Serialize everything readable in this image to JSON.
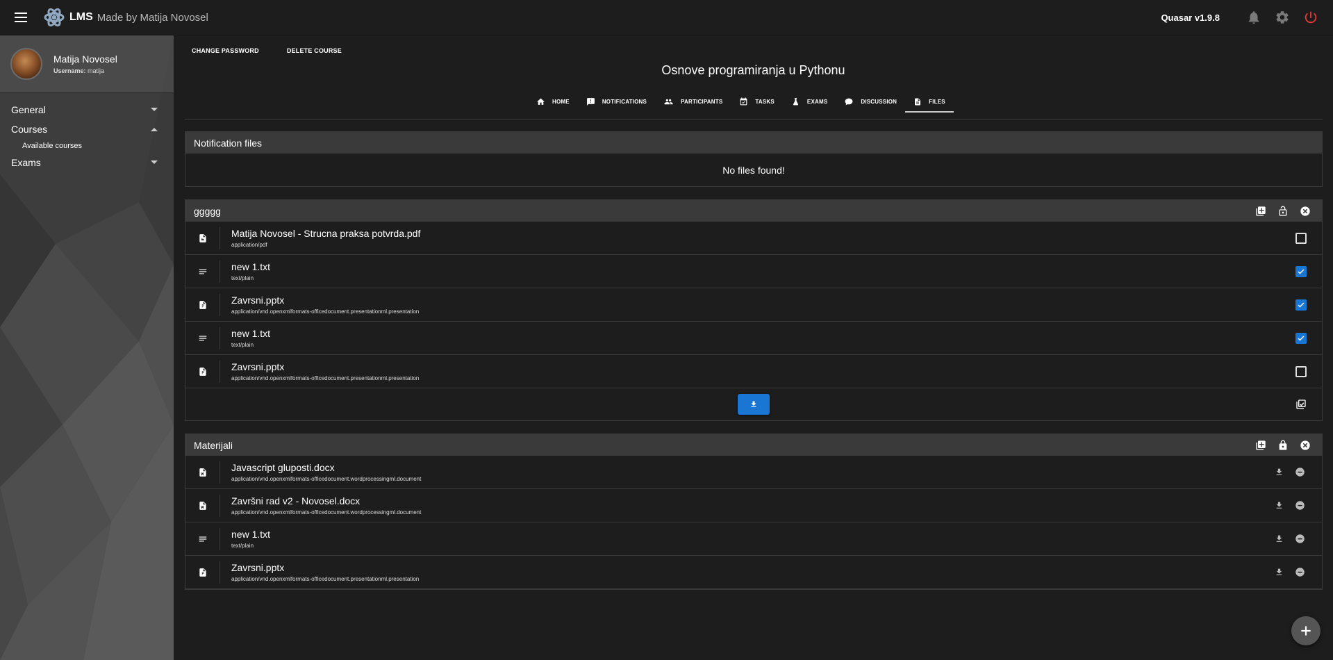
{
  "header": {
    "app_title": "LMS",
    "app_subtitle": "Made by Matija Novosel",
    "version": "Quasar v1.9.8",
    "icons": [
      "menu-icon",
      "atom-logo-icon",
      "bell-icon",
      "gear-icon",
      "power-icon"
    ]
  },
  "sidebar": {
    "user": {
      "name": "Matija Novosel",
      "username_label": "Username:",
      "username": "matija"
    },
    "items": [
      {
        "label": "General",
        "state": "collapsed"
      },
      {
        "label": "Courses",
        "state": "expanded"
      },
      {
        "label": "Available courses"
      },
      {
        "label": "Exams",
        "state": "collapsed"
      }
    ]
  },
  "main": {
    "actions": {
      "change_password": "CHANGE PASSWORD",
      "delete_course": "DELETE COURSE"
    },
    "course_title": "Osnove programiranja u Pythonu",
    "tabs": [
      {
        "label": "HOME",
        "icon": "home-icon"
      },
      {
        "label": "NOTIFICATIONS",
        "icon": "feedback-icon"
      },
      {
        "label": "PARTICIPANTS",
        "icon": "people-icon"
      },
      {
        "label": "TASKS",
        "icon": "event-available-icon"
      },
      {
        "label": "EXAMS",
        "icon": "flask-icon"
      },
      {
        "label": "DISCUSSION",
        "icon": "forum-icon"
      },
      {
        "label": "FILES",
        "icon": "file-icon",
        "active": true
      }
    ],
    "notification_files": {
      "title": "Notification files",
      "empty_text": "No files found!"
    },
    "folder1": {
      "title": "ggggg",
      "files": [
        {
          "name": "Matija Novosel - Strucna praksa potvrda.pdf",
          "mime": "application/pdf",
          "icon": "pdf-file-icon",
          "checked": false
        },
        {
          "name": "new 1.txt",
          "mime": "text/plain",
          "icon": "text-lines-icon",
          "checked": true
        },
        {
          "name": "Zavrsni.pptx",
          "mime": "application/vnd.openxmlformats-officedocument.presentationml.presentation",
          "icon": "pptx-file-icon",
          "checked": true
        },
        {
          "name": "new 1.txt",
          "mime": "text/plain",
          "icon": "text-lines-icon",
          "checked": true
        },
        {
          "name": "Zavrsni.pptx",
          "mime": "application/vnd.openxmlformats-officedocument.presentationml.presentation",
          "icon": "pptx-file-icon",
          "checked": false
        }
      ]
    },
    "folder2": {
      "title": "Materijali",
      "files": [
        {
          "name": "Javascript gluposti.docx",
          "mime": "application/vnd.openxmlformats-officedocument.wordprocessingml.document",
          "icon": "docx-file-icon"
        },
        {
          "name": "Završni rad v2 - Novosel.docx",
          "mime": "application/vnd.openxmlformats-officedocument.wordprocessingml.document",
          "icon": "docx-file-icon"
        },
        {
          "name": "new 1.txt",
          "mime": "text/plain",
          "icon": "text-lines-icon"
        },
        {
          "name": "Zavrsni.pptx",
          "mime": "application/vnd.openxmlformats-officedocument.presentationml.presentation",
          "icon": "pptx-file-icon"
        }
      ]
    }
  },
  "colors": {
    "accent": "#1976d2",
    "header_bg": "#1d1d1d",
    "sidebar_bg": "#3a3a3a",
    "danger": "#e53935"
  }
}
